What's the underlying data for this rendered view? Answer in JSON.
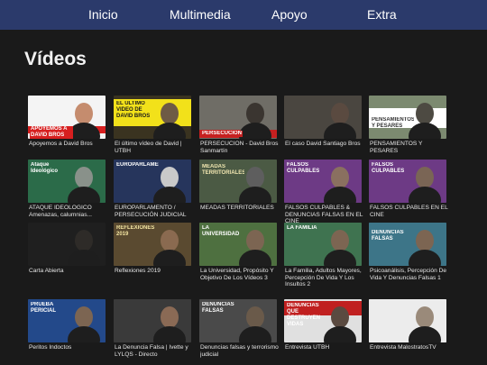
{
  "nav": {
    "items": [
      "Inicio",
      "Multimedia",
      "Apoyo",
      "Extra"
    ]
  },
  "page": {
    "title": "Vídeos"
  },
  "videos": [
    {
      "caption": "Apoyemos a David Bros",
      "thumb": "apoyemos",
      "badge": "APOYEMOS A DAVID BROS"
    },
    {
      "caption": "El último vídeo de David | UTBH",
      "thumb": "ultimo",
      "badge": "EL ÚLTIMO VIDEO DE DAVID BROS"
    },
    {
      "caption": "PERSECUCIÓN - David Bros Sanmartín",
      "thumb": "persecucion",
      "badge": "PERSECUCIÓN"
    },
    {
      "caption": "El caso David Santiago Bros",
      "thumb": "caso",
      "badge": ""
    },
    {
      "caption": "PENSAMIENTOS Y PESARES",
      "thumb": "pensamientos",
      "badge": "PENSAMIENTOS Y PESARES"
    },
    {
      "caption": "ATAQUE IDEOLÓGICO Amenazas, calumnias...",
      "thumb": "ataque",
      "badge": "Ataque Ideológico"
    },
    {
      "caption": "EUROPARLAMENTO / PERSECUCIÓN JUDICIAL",
      "thumb": "europarlamento",
      "badge": "EUROPARLAMENTO"
    },
    {
      "caption": "MEADAS TERRITORIALES",
      "thumb": "meadas",
      "badge": "MEADAS TERRITORIALES"
    },
    {
      "caption": "FALSOS CULPABLES & DENUNCIAS FALSAS EN EL CINE",
      "thumb": "falsos1",
      "badge": "FALSOS CULPABLES"
    },
    {
      "caption": "FALSOS CULPABLES EN EL CINE",
      "thumb": "falsos2",
      "badge": "FALSOS CULPABLES"
    },
    {
      "caption": "Carta Abierta",
      "thumb": "carta",
      "badge": ""
    },
    {
      "caption": "Reflexiones 2019",
      "thumb": "reflexiones",
      "badge": "REFLEXIONES 2019"
    },
    {
      "caption": "La Universidad, Propósito Y Objetivo De Los Vídeos 3",
      "thumb": "universidad",
      "badge": "LA UNIVERSIDAD"
    },
    {
      "caption": "La Familia, Adultos Mayores, Percepción De Vida Y Los Insultos 2",
      "thumb": "familia",
      "badge": "LA FAMILIA"
    },
    {
      "caption": "Psicoanálisis, Percepción De Vida Y Denuncias Falsas 1",
      "thumb": "psico",
      "badge": "DENUNCIAS FALSAS"
    },
    {
      "caption": "Peritos Indoctos",
      "thumb": "peritos",
      "badge": "PRUEBA PERICIAL"
    },
    {
      "caption": "La Denuncia Falsa | Ivette y LYLQS - Directo",
      "thumb": "directo",
      "badge": ""
    },
    {
      "caption": "Denuncias falsas y terrorismo judicial",
      "thumb": "terrorismo",
      "badge": "DENUNCIAS FALSAS"
    },
    {
      "caption": "Entrevista UTBH",
      "thumb": "utbh",
      "badge": "DENUNCIAS QUE DESTRUYEN VIDAS"
    },
    {
      "caption": "Entrevista MalostratosTV",
      "thumb": "malostratos",
      "badge": ""
    }
  ]
}
